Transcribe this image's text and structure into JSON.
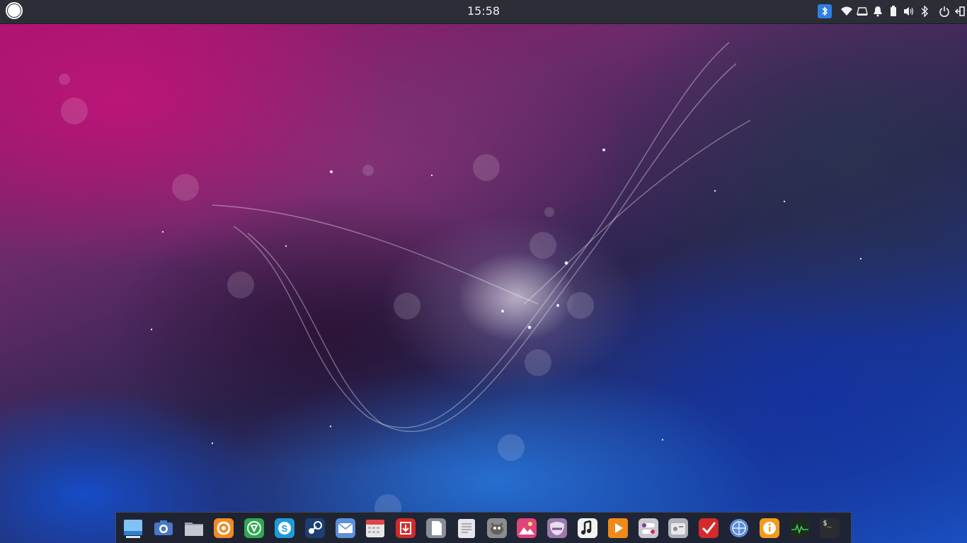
{
  "panel": {
    "clock": "15:58",
    "launcher_icon": "menu-circle-icon",
    "tray": [
      "bluetooth-app-icon",
      "wifi-icon",
      "display-icon",
      "notification-bell-icon",
      "battery-icon",
      "volume-icon",
      "bluetooth-icon",
      "power-icon",
      "logout-icon"
    ]
  },
  "dock": {
    "items": [
      {
        "icon": "desktop-icon",
        "color": "#3a8fd8"
      },
      {
        "icon": "screenshot-camera-icon",
        "color": "#4a78c8"
      },
      {
        "icon": "files-folder-icon",
        "color": "#8a8f9a"
      },
      {
        "icon": "firefox-icon",
        "color": "#f08a24"
      },
      {
        "icon": "chrome-icon",
        "color": "#2fa84f"
      },
      {
        "icon": "skype-icon",
        "color": "#1e9ad6"
      },
      {
        "icon": "steam-icon",
        "color": "#1c3f72"
      },
      {
        "icon": "mail-icon",
        "color": "#5b8fd6"
      },
      {
        "icon": "calendar-icon",
        "color": "#e8e8e8"
      },
      {
        "icon": "software-store-icon",
        "color": "#d42a2a"
      },
      {
        "icon": "text-editor-icon",
        "color": "#8a8d96"
      },
      {
        "icon": "document-viewer-icon",
        "color": "#e6e6ea"
      },
      {
        "icon": "gimp-icon",
        "color": "#8c8c8c"
      },
      {
        "icon": "photos-icon",
        "color": "#e0457a"
      },
      {
        "icon": "mask-app-icon",
        "color": "#9a7aa8"
      },
      {
        "icon": "music-icon",
        "color": "#f2f2f2"
      },
      {
        "icon": "media-player-icon",
        "color": "#f0891c"
      },
      {
        "icon": "settings-toggle-icon",
        "color": "#c8c8d0"
      },
      {
        "icon": "radio-icon",
        "color": "#b0b0b6"
      },
      {
        "icon": "task-check-icon",
        "color": "#d42a2a"
      },
      {
        "icon": "network-globe-icon",
        "color": "#5e8ed8"
      },
      {
        "icon": "info-icon",
        "color": "#f29a1c"
      },
      {
        "icon": "system-monitor-icon",
        "color": "#1e2a22"
      },
      {
        "icon": "terminal-icon",
        "color": "#2a2c30",
        "text": "$_"
      }
    ]
  }
}
